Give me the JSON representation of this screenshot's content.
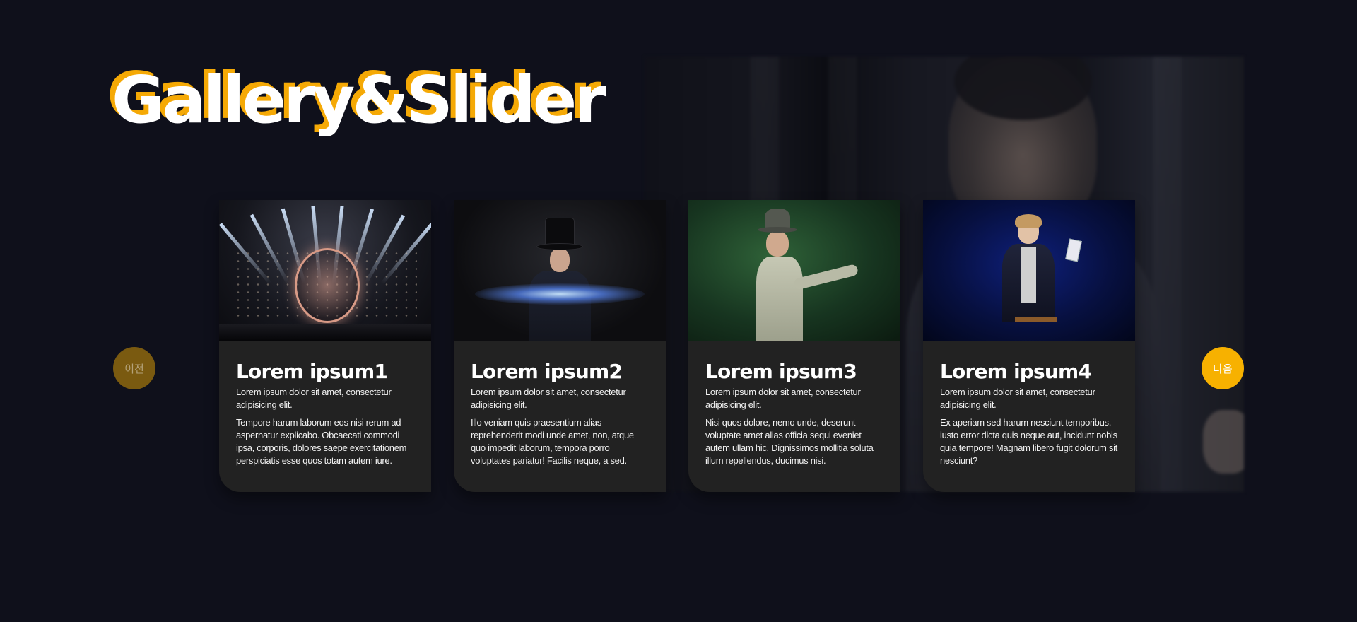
{
  "page": {
    "title": "Gallery&Slider"
  },
  "nav": {
    "prev_label": "이전",
    "next_label": "다음"
  },
  "colors": {
    "background": "#0f101b",
    "accent": "#f7b100",
    "card_bg": "#222222"
  },
  "cards": [
    {
      "title": "Lorem ipsum1",
      "subtitle": "Lorem ipsum dolor sit amet, consectetur adipisicing elit.",
      "body": "Tempore harum laborum eos nisi rerum ad aspernatur explicabo. Obcaecati commodi ipsa, corporis, dolores saepe exercitationem perspiciatis esse quos totam autem iure."
    },
    {
      "title": "Lorem ipsum2",
      "subtitle": "Lorem ipsum dolor sit amet, consectetur adipisicing elit.",
      "body": "Illo veniam quis praesentium alias reprehenderit modi unde amet, non, atque quo impedit laborum, tempora porro voluptates pariatur! Facilis neque, a sed."
    },
    {
      "title": "Lorem ipsum3",
      "subtitle": "Lorem ipsum dolor sit amet, consectetur adipisicing elit.",
      "body": "Nisi quos dolore, nemo unde, deserunt voluptate amet alias officia sequi eveniet autem ullam hic. Dignissimos mollitia soluta illum repellendus, ducimus nisi."
    },
    {
      "title": "Lorem ipsum4",
      "subtitle": "Lorem ipsum dolor sit amet, consectetur adipisicing elit.",
      "body": "Ex aperiam sed harum nesciunt temporibus, iusto error dicta quis neque aut, incidunt nobis quia tempore! Magnam libero fugit dolorum sit nesciunt?"
    }
  ]
}
